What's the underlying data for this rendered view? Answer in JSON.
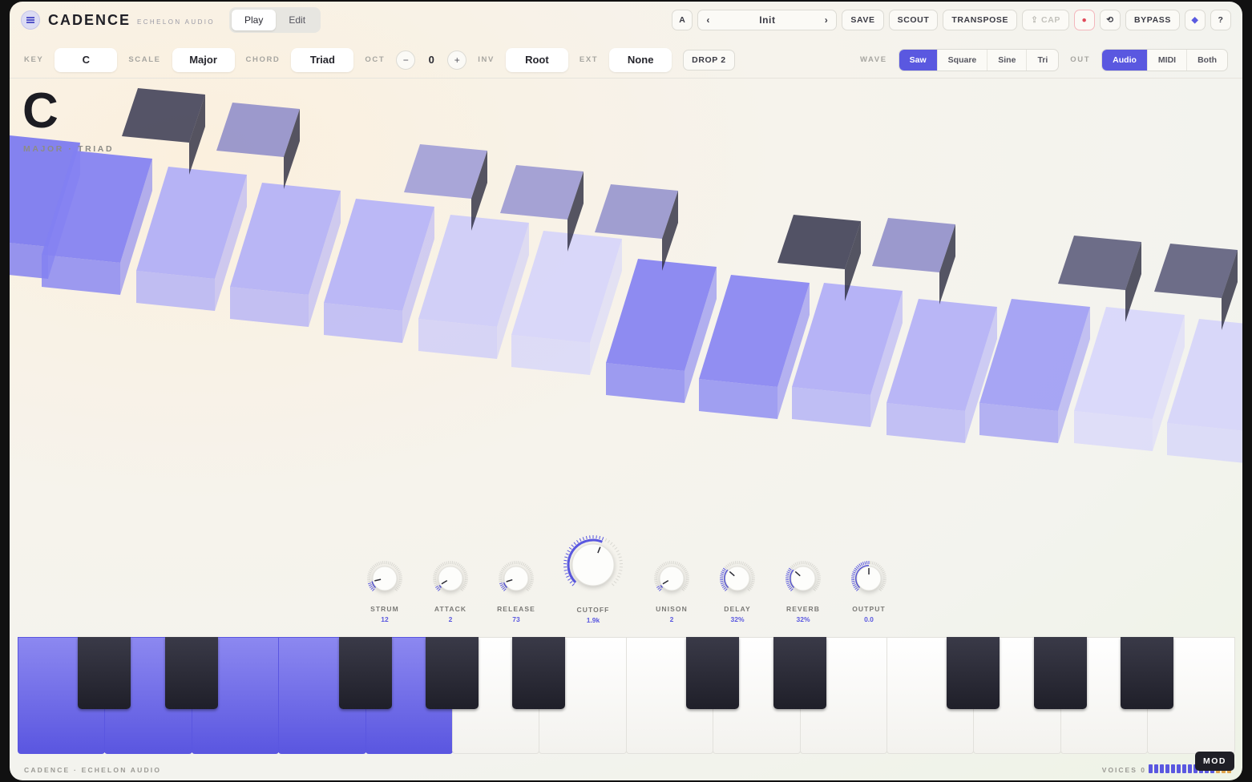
{
  "app": {
    "title": "CADENCE",
    "vendor": "ECHELON AUDIO"
  },
  "mode_tabs": [
    "Play",
    "Edit"
  ],
  "mode_active": "Play",
  "topbar": {
    "ab_label": "A",
    "preset_prev": "‹",
    "preset_name": "Init",
    "preset_next": "›",
    "save": "SAVE",
    "scout": "SCOUT",
    "transpose": "TRANSPOSE",
    "cap": "⇪ CAP",
    "record": "●",
    "undo": "⟲",
    "bypass": "BYPASS",
    "diamond": "◆",
    "help": "?"
  },
  "controls": {
    "key_label": "KEY",
    "key": "C",
    "scale_label": "SCALE",
    "scale": "Major",
    "chord_label": "CHORD",
    "chord": "Triad",
    "oct_label": "OCT",
    "oct_minus": "−",
    "oct": "0",
    "oct_plus": "+",
    "inv_label": "INV",
    "inv": "Root",
    "ext_label": "EXT",
    "ext": "None",
    "drop": "DROP 2",
    "wave_label": "WAVE",
    "waves": [
      "Saw",
      "Square",
      "Sine",
      "Tri"
    ],
    "wave_active": "Saw",
    "out_label": "OUT",
    "outs": [
      "Audio",
      "MIDI",
      "Both"
    ],
    "out_active": "Audio"
  },
  "display": {
    "note": "C",
    "subtitle": "MAJOR · TRIAD"
  },
  "knobs": [
    {
      "label": "STRUM",
      "value": "12",
      "level": 0.12
    },
    {
      "label": "ATTACK",
      "value": "2",
      "level": 0.05
    },
    {
      "label": "RELEASE",
      "value": "73",
      "level": 0.1
    },
    {
      "label": "CUTOFF",
      "value": "1.9k",
      "level": 0.58
    },
    {
      "label": "UNISON",
      "value": "2",
      "level": 0.05
    },
    {
      "label": "DELAY",
      "value": "32%",
      "level": 0.32
    },
    {
      "label": "REVERB",
      "value": "32%",
      "level": 0.32
    },
    {
      "label": "OUTPUT",
      "value": "0.0",
      "level": 0.5
    }
  ],
  "colors": {
    "accent": "#5a58e0",
    "black_key": "#1f1f29"
  },
  "footer": {
    "brand": "CADENCE · ECHELON AUDIO",
    "voices": "VOICES 0",
    "mod": "MOD"
  }
}
